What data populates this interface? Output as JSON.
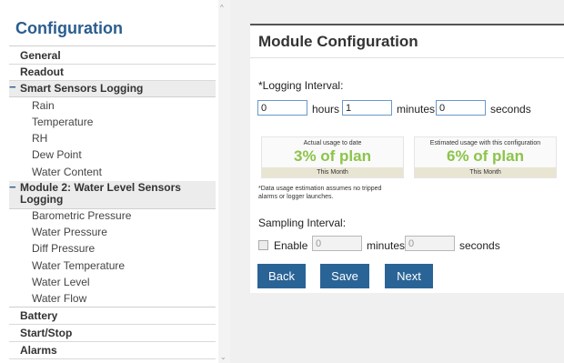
{
  "sidebar": {
    "title": "Configuration",
    "items": [
      {
        "label": "General"
      },
      {
        "label": "Readout"
      },
      {
        "label": "Smart Sensors Logging",
        "collapse_glyph": "−"
      },
      {
        "label": "Rain"
      },
      {
        "label": "Temperature"
      },
      {
        "label": "RH"
      },
      {
        "label": "Dew Point"
      },
      {
        "label": "Water Content"
      },
      {
        "label": "Module 2: Water Level Sensors Logging",
        "collapse_glyph": "−"
      },
      {
        "label": "Barometric Pressure"
      },
      {
        "label": "Water Pressure"
      },
      {
        "label": "Diff Pressure"
      },
      {
        "label": "Water Temperature"
      },
      {
        "label": "Water Level"
      },
      {
        "label": "Water Flow"
      },
      {
        "label": "Battery"
      },
      {
        "label": "Start/Stop"
      },
      {
        "label": "Alarms"
      }
    ]
  },
  "scrollbar": {
    "up_glyph": "^",
    "down_glyph": "⌄"
  },
  "panel": {
    "title": "Module Configuration",
    "logging_interval": {
      "label": "*Logging Interval:",
      "hours_value": "0",
      "hours_label": "hours",
      "minutes_value": "1",
      "minutes_label": "minutes",
      "seconds_value": "0",
      "seconds_label": "seconds"
    },
    "usage_actual": {
      "caption": "Actual usage to date",
      "percent": "3% of plan",
      "period": "This Month"
    },
    "usage_estimated": {
      "caption": "Estimated usage with this configuration",
      "percent": "6% of plan",
      "period": "This Month"
    },
    "note": "*Data usage estimation assumes no tripped alarms or logger launches.",
    "sampling_interval": {
      "label": "Sampling Interval:",
      "enable_label": "Enable",
      "minutes_value": "0",
      "minutes_label": "minutes",
      "seconds_value": "0",
      "seconds_label": "seconds"
    },
    "buttons": {
      "back": "Back",
      "save": "Save",
      "next": "Next"
    }
  },
  "colors": {
    "accent": "#2a6496",
    "usage_green": "#8cc44a",
    "title_blue": "#2a5d8f"
  }
}
